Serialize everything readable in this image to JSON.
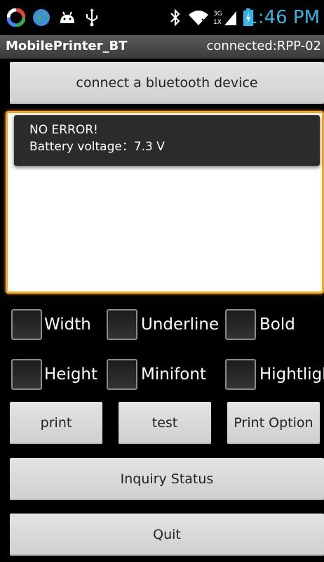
{
  "status_bar": {
    "time": "1:46 PM",
    "icons": [
      "sync-icon",
      "globe-icon",
      "android-icon",
      "usb-icon",
      "bluetooth-icon",
      "wifi-icon",
      "signal-3g-icon",
      "battery-charging-icon"
    ],
    "network_type_top": "3G",
    "network_type_bottom": "1X"
  },
  "title_bar": {
    "app_title": "MobilePrinter_BT",
    "connection_status": "connected:RPP-02"
  },
  "connect_button": {
    "label": "connect a bluetooth device"
  },
  "toast": {
    "line1": "NO ERROR!",
    "line2": "Battery voltage：7.3 V"
  },
  "options": {
    "width": "Width",
    "underline": "Underline",
    "bold": "Bold",
    "height": "Height",
    "minifont": "Minifont",
    "highlight": "Hightligh"
  },
  "actions": {
    "print": "print",
    "test": "test",
    "print_option": "Print Option",
    "inquiry_status": "Inquiry Status",
    "quit": "Quit"
  },
  "colors": {
    "accent": "#33b5e5",
    "focus_border": "#f5a623"
  }
}
